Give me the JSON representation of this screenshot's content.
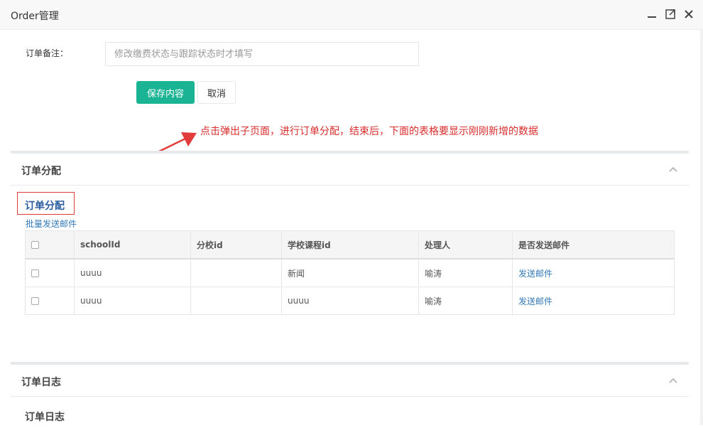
{
  "window": {
    "title": "Order管理"
  },
  "form": {
    "remark_label": "订单备注：",
    "remark_placeholder": "修改缴费状态与跟踪状态时才填写",
    "save_label": "保存内容",
    "cancel_label": "取消"
  },
  "annotation": {
    "text": "点击弹出子页面，进行订单分配，结束后，下面的表格要显示刚刚新增的数据",
    "color": "#d92d2d"
  },
  "allocation_panel": {
    "title": "订单分配",
    "sub_title": "订单分配",
    "batch_link": "批量发送邮件",
    "columns": [
      "schoolId",
      "分校id",
      "学校课程id",
      "处理人",
      "是否发送邮件"
    ],
    "rows": [
      {
        "schoolId": "uuuu",
        "branch_id": "",
        "course_id": "新闻",
        "handler": "喻涛",
        "action": "发送邮件"
      },
      {
        "schoolId": "uuuu",
        "branch_id": "",
        "course_id": "uuuu",
        "handler": "喻涛",
        "action": "发送邮件"
      }
    ]
  },
  "log_panel": {
    "title": "订单日志",
    "sub_title": "订单日志"
  },
  "colors": {
    "accent": "#1ab394",
    "link": "#337ab7",
    "highlight_border": "#e23b3b"
  },
  "icons": [
    "minimize-icon",
    "maximize-icon",
    "close-icon",
    "chevron-up-icon",
    "checkbox-icon",
    "arrow-icon"
  ]
}
